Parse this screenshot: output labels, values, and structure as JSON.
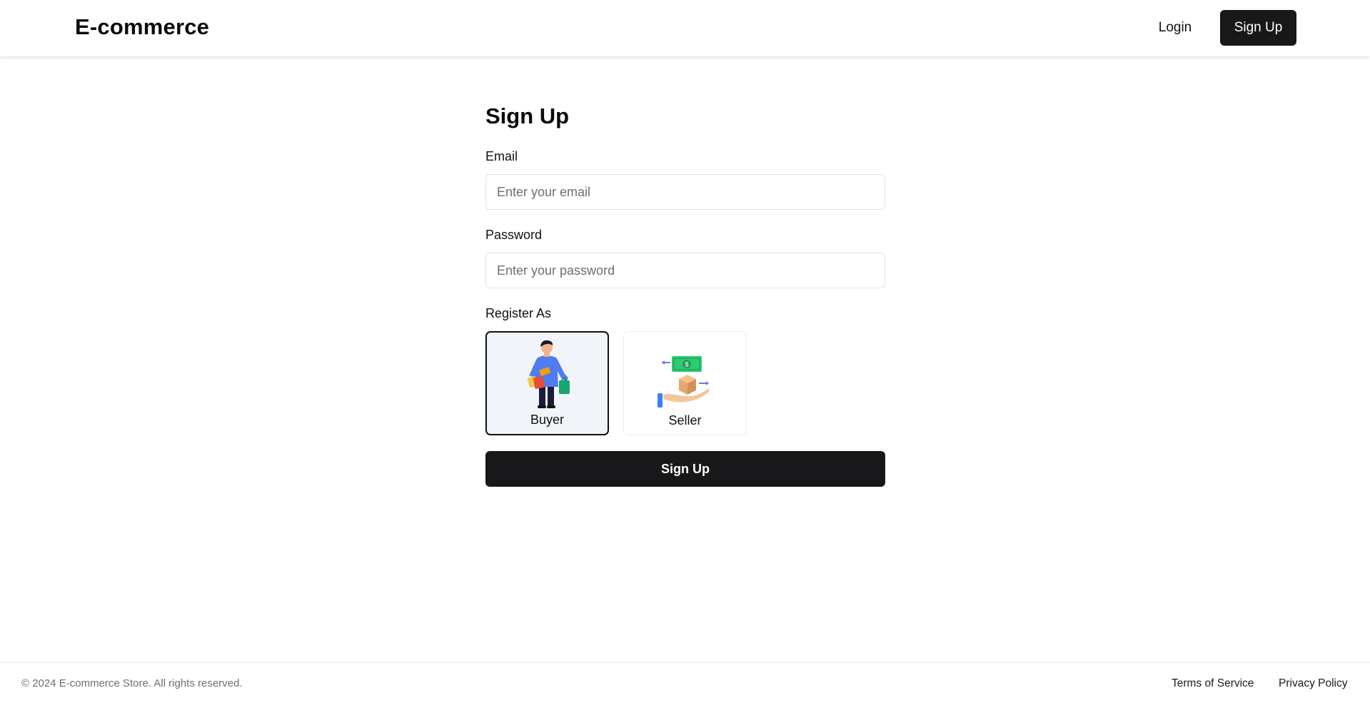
{
  "header": {
    "brand": "E-commerce",
    "login_label": "Login",
    "signup_label": "Sign Up"
  },
  "form": {
    "title": "Sign Up",
    "email": {
      "label": "Email",
      "placeholder": "Enter your email",
      "value": ""
    },
    "password": {
      "label": "Password",
      "placeholder": "Enter your password",
      "value": ""
    },
    "register_as_label": "Register As",
    "roles": [
      {
        "label": "Buyer",
        "icon": "buyer-shopping-icon",
        "selected": true
      },
      {
        "label": "Seller",
        "icon": "seller-money-box-icon",
        "selected": false
      }
    ],
    "submit_label": "Sign Up"
  },
  "footer": {
    "copyright": "© 2024 E-commerce Store. All rights reserved.",
    "links": [
      "Terms of Service",
      "Privacy Policy"
    ]
  },
  "colors": {
    "primary_button": "#18181b",
    "selected_card_bg": "#f1f4f9",
    "input_border": "#e2e4e8"
  }
}
